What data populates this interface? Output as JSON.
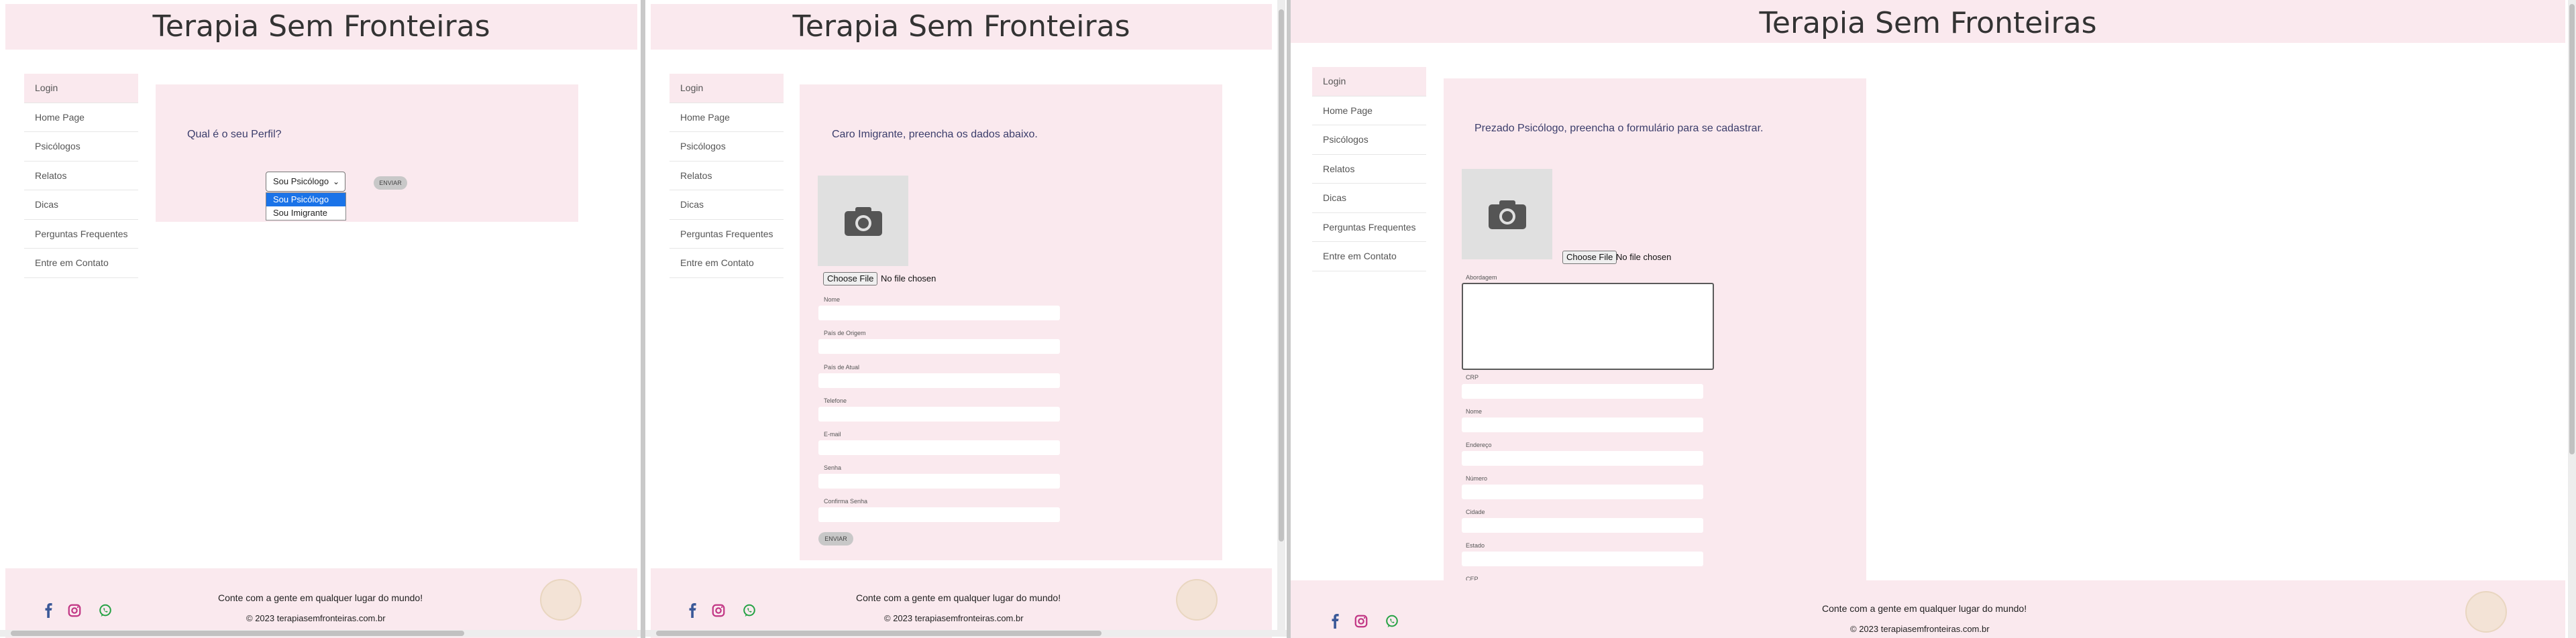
{
  "site": {
    "title": "Terapia Sem Fronteiras",
    "nav": [
      "Login",
      "Home Page",
      "Psicólogos",
      "Relatos",
      "Dicas",
      "Perguntas Frequentes",
      "Entre em Contato"
    ]
  },
  "login": {
    "question": "Qual é o seu Perfil?",
    "selected": "Sou Psicólogo",
    "options": [
      "Sou Psicólogo",
      "Sou Imigrante"
    ],
    "send": "ENVIAR"
  },
  "immigrant": {
    "intro": "Caro Imigrante, preencha os dados abaixo.",
    "file_button": "Choose File",
    "file_status": "No file chosen",
    "fields": [
      "Nome",
      "País de Origem",
      "País de Atual",
      "Telefone",
      "E-mail",
      "Senha",
      "Confirma Senha"
    ],
    "send": "ENVIAR"
  },
  "psychologist": {
    "intro": "Prezado Psicólogo, preencha o formulário para se cadastrar.",
    "file_button": "Choose File",
    "file_status": "No file chosen",
    "textarea_label": "Abordagem",
    "fields": [
      "CRP",
      "Nome",
      "Endereço",
      "Número",
      "Cidade",
      "Estado",
      "CEP"
    ]
  },
  "footer": {
    "tagline": "Conte com a gente em qualquer lugar do mundo!",
    "copyright": "© 2023 terapiasemfronteiras.com.br"
  },
  "icons": [
    "facebook-icon",
    "instagram-icon",
    "whatsapp-icon",
    "camera-icon",
    "chevron-down-icon"
  ],
  "colors": {
    "pink": "#fae9ee",
    "text_blue": "#3b3d6b",
    "facebook": "#3b5998",
    "instagram": "#c13584",
    "whatsapp": "#25a244"
  }
}
